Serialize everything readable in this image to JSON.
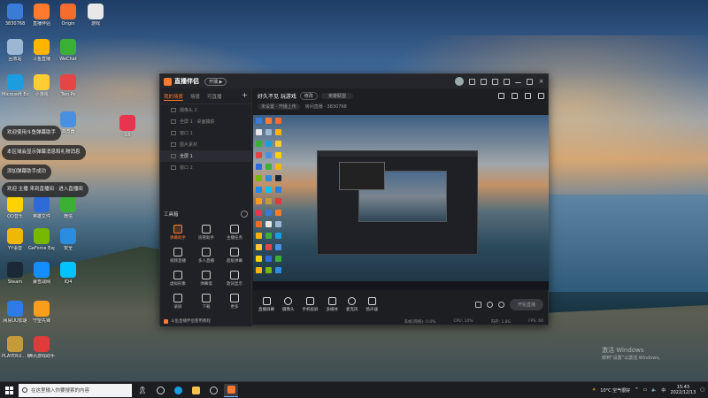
{
  "desktop_icons": [
    {
      "label": "3830768",
      "color": "#3a7bd5"
    },
    {
      "label": "直播伴侣",
      "color": "#ff7a2f"
    },
    {
      "label": "Origin",
      "color": "#f56c2d"
    },
    {
      "label": "游戏",
      "color": "#e8e8e8"
    },
    {
      "label": "回收站",
      "color": "#9bb7d4"
    },
    {
      "label": "斗鱼直播",
      "color": "#ffb400"
    },
    {
      "label": "WeChat",
      "color": "#3cb034"
    },
    {
      "label": "Microsoft Edge",
      "color": "#1b9de2"
    },
    {
      "label": "小游戏",
      "color": "#ffcc33"
    },
    {
      "label": "Two Po",
      "color": "#e64545"
    },
    {
      "label": "浏览器",
      "color": "#4a90e2"
    },
    {
      "label": "QQ音乐",
      "color": "#ffd200"
    },
    {
      "label": "英雄文件",
      "color": "#2e6bd8"
    },
    {
      "label": "微信",
      "color": "#3cb034"
    },
    {
      "label": "YY语音",
      "color": "#f2b705"
    },
    {
      "label": "GeForce Experience",
      "color": "#76b900"
    },
    {
      "label": "安全",
      "color": "#2a8de0"
    },
    {
      "label": "Steam",
      "color": "#1b2838"
    },
    {
      "label": "暴雪战网",
      "color": "#148eff"
    },
    {
      "label": "IQ4",
      "color": "#00c4ff"
    },
    {
      "label": "网易UU加速",
      "color": "#2d7be5"
    },
    {
      "label": "守望先锋",
      "color": "#f99e1a"
    },
    {
      "label": "PLAYERU... BATTLEGR...",
      "color": "#c49a3a"
    },
    {
      "label": "腾讯游戏助手",
      "color": "#e03a3a"
    },
    {
      "label": "G6",
      "color": "#e8344e"
    }
  ],
  "notifications": [
    "欢迎使用斗鱼弹幕助手",
    "本区域会显示弹幕消息和礼物消息",
    "添加弹幕助手成功",
    "欢迎 主播 来到直播间 · 进入直播间"
  ],
  "window": {
    "app_name": "直播伴侣",
    "version_badge": "开播 ▶",
    "left_tabs": [
      "我的场景",
      "场景",
      "可直播"
    ],
    "add_label": "+",
    "sources": [
      {
        "label": "摄像头 2",
        "selected": false
      },
      {
        "label": "全屏 1 · 桌面捕获",
        "selected": false
      },
      {
        "label": "窗口 1",
        "selected": false
      },
      {
        "label": "图片素材",
        "selected": false
      },
      {
        "label": "全屏 1",
        "selected": true
      },
      {
        "label": "窗口 2",
        "selected": false
      }
    ],
    "tools_title": "工具箱",
    "tools": [
      {
        "label": "弹幕助手",
        "active": true
      },
      {
        "label": "房管助手",
        "active": false
      },
      {
        "label": "主播任务",
        "active": false
      },
      {
        "label": "视频直播",
        "active": false
      },
      {
        "label": "多人直播",
        "active": false
      },
      {
        "label": "超级弹幕",
        "active": false
      },
      {
        "label": "虚拟形象",
        "active": false
      },
      {
        "label": "弹幕墙",
        "active": false
      },
      {
        "label": "歌词显示",
        "active": false
      },
      {
        "label": "录屏",
        "active": false
      },
      {
        "label": "下载",
        "active": false
      },
      {
        "label": "更多",
        "active": false
      }
    ],
    "footer_text": "斗鱼直播伴侣使用教程",
    "stream_title": "好久不见 玩游戏",
    "edit_label": "修改",
    "category": "英雄联盟",
    "room_tag": "未设置 · 开播上传",
    "room_id": "房间直播 · 3830768",
    "controls": [
      "直播屏幕",
      "摄像头",
      "手机投屏",
      "多媒体",
      "麦克风",
      "扬声器"
    ],
    "start_button": "开始直播",
    "status": [
      "丢帧(网络): 0.0%",
      "CPU: 10%",
      "内存: 1.8G",
      "FPS: 60"
    ]
  },
  "watermark": {
    "line1": "激活 Windows",
    "line2": "转到“设置”以激活 Windows。"
  },
  "taskbar": {
    "search_placeholder": "在这里输入你要搜索的内容",
    "weather": "10°C 空气很好",
    "time": "15:43",
    "date": "2022/12/13"
  }
}
